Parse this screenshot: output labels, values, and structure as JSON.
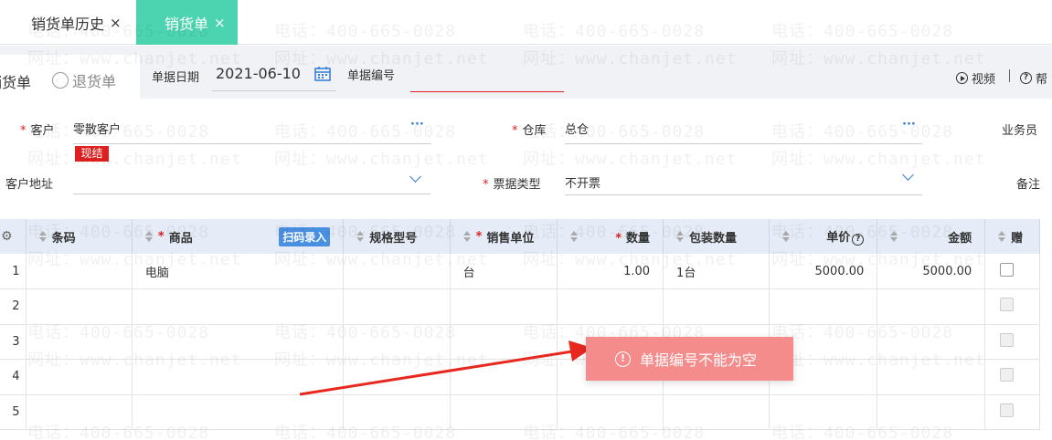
{
  "tabs": [
    {
      "label": "销货单历史",
      "close": "×"
    },
    {
      "label": "销货单",
      "close": "×"
    }
  ],
  "toolbar": {
    "type_selected": "销货单",
    "type_other": "退货单",
    "date_label": "单据日期",
    "date_value": "2021-06-10",
    "code_label": "单据编号",
    "video_label": "视频",
    "help_label": "帮"
  },
  "form": {
    "customer_label": "客户",
    "customer_value": "零散客户",
    "customer_badge": "现结",
    "warehouse_label": "仓库",
    "warehouse_value": "总仓",
    "salesman_label": "业务员",
    "address_label": "客户地址",
    "invoice_label": "票据类型",
    "invoice_value": "不开票",
    "remark_label": "备注",
    "more_glyph": "···"
  },
  "grid": {
    "headers": {
      "barcode": "条码",
      "product": "商品",
      "scan": "扫码录入",
      "spec": "规格型号",
      "unit": "销售单位",
      "qty": "数量",
      "pack_qty": "包装数量",
      "price": "单价",
      "amount": "金额",
      "gift": "赠",
      "required": "*",
      "help": "?"
    },
    "rows": [
      {
        "no": "1",
        "product": "电脑",
        "unit": "台",
        "qty": "1.00",
        "pack_qty": "1台",
        "price": "5000.00",
        "amount": "5000.00"
      },
      {
        "no": "2"
      },
      {
        "no": "3"
      },
      {
        "no": "4"
      },
      {
        "no": "5"
      }
    ]
  },
  "watermark": {
    "phone": "电话：400-665-0028",
    "site": "网址：www.chanjet.net"
  },
  "toast": {
    "icon": "!",
    "message": "单据编号不能为空",
    "background": "#f48c8c"
  },
  "colors": {
    "accent_tab": "#4cd4b0",
    "required": "#e02020",
    "link": "#2f7bd6",
    "grid_header": "#e6ecf7"
  }
}
